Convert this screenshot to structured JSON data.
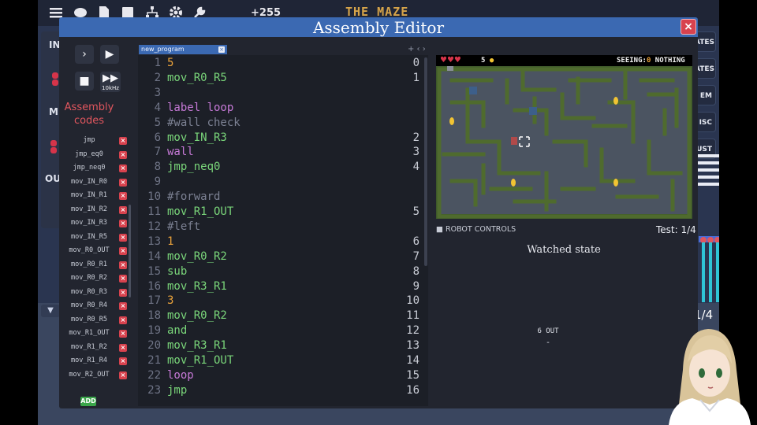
{
  "topbar": {
    "count": "+255",
    "game_title": "THE MAZE"
  },
  "left_panel": {
    "labels": [
      "IN",
      "ME",
      "OUT"
    ]
  },
  "right_panel": {
    "buttons": [
      "ATES",
      "ATES",
      "EM",
      "ISC",
      "UST"
    ],
    "fraction": "1/4"
  },
  "dialog": {
    "title": "Assembly Editor",
    "close_label": "×"
  },
  "controls": {
    "step_glyph": "›",
    "play_glyph": "▶",
    "stop_glyph": "■",
    "fast_glyph": "▶▶",
    "speed_label": "10kHz"
  },
  "codes_panel": {
    "title": "Assembly codes",
    "items": [
      "jmp",
      "jmp_eq0",
      "jmp_neq0",
      "mov_IN_R0",
      "mov_IN_R1",
      "mov_IN_R2",
      "mov_IN_R3",
      "mov_IN_R5",
      "mov_R0_OUT",
      "mov_R0_R1",
      "mov_R0_R2",
      "mov_R0_R3",
      "mov_R0_R4",
      "mov_R0_R5",
      "mov_R1_OUT",
      "mov_R1_R2",
      "mov_R1_R4",
      "mov_R2_OUT"
    ],
    "remove_label": "×",
    "add_label": "ADD"
  },
  "editor": {
    "tab_name": "new_program",
    "tab_close": "×",
    "tab_nav": "+ ‹ ›",
    "lines": [
      {
        "n": "1",
        "text": "5",
        "type": "num",
        "addr": "0"
      },
      {
        "n": "2",
        "text": "mov_R0_R5",
        "type": "op",
        "addr": "1"
      },
      {
        "n": "3",
        "text": "",
        "type": "op",
        "addr": ""
      },
      {
        "n": "4",
        "text": "label loop",
        "type": "kw",
        "addr": ""
      },
      {
        "n": "5",
        "text": "#wall check",
        "type": "cm",
        "addr": ""
      },
      {
        "n": "6",
        "text": "mov_IN_R3",
        "type": "op",
        "addr": "2"
      },
      {
        "n": "7",
        "text": "wall",
        "type": "kw",
        "addr": "3"
      },
      {
        "n": "8",
        "text": "jmp_neq0",
        "type": "op",
        "addr": "4"
      },
      {
        "n": "9",
        "text": "",
        "type": "op",
        "addr": ""
      },
      {
        "n": "10",
        "text": "#forward",
        "type": "cm",
        "addr": ""
      },
      {
        "n": "11",
        "text": "mov_R1_OUT",
        "type": "op",
        "addr": "5"
      },
      {
        "n": "12",
        "text": "#left",
        "type": "cm",
        "addr": ""
      },
      {
        "n": "13",
        "text": "1",
        "type": "num",
        "addr": "6"
      },
      {
        "n": "14",
        "text": "mov_R0_R2",
        "type": "op",
        "addr": "7"
      },
      {
        "n": "15",
        "text": "sub",
        "type": "op",
        "addr": "8"
      },
      {
        "n": "16",
        "text": "mov_R3_R1",
        "type": "op",
        "addr": "9"
      },
      {
        "n": "17",
        "text": "3",
        "type": "num",
        "addr": "10"
      },
      {
        "n": "18",
        "text": "mov_R0_R2",
        "type": "op",
        "addr": "11"
      },
      {
        "n": "19",
        "text": "and",
        "type": "op",
        "addr": "12"
      },
      {
        "n": "20",
        "text": "mov_R3_R1",
        "type": "op",
        "addr": "13"
      },
      {
        "n": "21",
        "text": "mov_R1_OUT",
        "type": "op",
        "addr": "14"
      },
      {
        "n": "22",
        "text": "loop",
        "type": "kw",
        "addr": "15"
      },
      {
        "n": "23",
        "text": "jmp",
        "type": "op",
        "addr": "16"
      }
    ]
  },
  "game": {
    "hearts": "♥♥♥",
    "coins": "5",
    "seeing_prefix": "SEEING:",
    "seeing_value": "0",
    "seeing_text": "NOTHING",
    "robot_controls": "ROBOT CONTROLS",
    "test_label": "Test: 1/4",
    "watched_state": "Watched state",
    "out_label": "6 OUT",
    "out_value": "-"
  },
  "colors": {
    "accent": "#3b69b2",
    "danger": "#d8424e",
    "number": "#e9a23b",
    "keyword": "#c77ad8",
    "op": "#7ad67a",
    "comment": "#7c8193"
  }
}
